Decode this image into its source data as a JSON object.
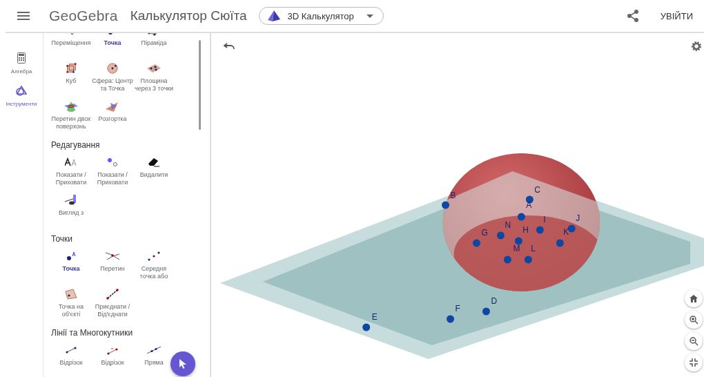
{
  "header": {
    "logo": "GeoGebra",
    "title": "Калькулятор Сюїта",
    "app_dropdown": "3D Калькулятор",
    "sign_in": "УВІЙТИ"
  },
  "rail": [
    {
      "label": "Алгебра",
      "selected": false
    },
    {
      "label": "Інструменти",
      "selected": true
    }
  ],
  "tool_sections": [
    {
      "tools": [
        {
          "label": "Переміщення",
          "selected": false
        },
        {
          "label": "Точка",
          "selected": true
        },
        {
          "label": "Піраміда",
          "selected": false
        },
        {
          "label": "Куб",
          "selected": false
        },
        {
          "label": "Сфера: Центр та Точка",
          "selected": false
        },
        {
          "label": "Площина через 3 точки",
          "selected": false
        },
        {
          "label": "Перетин двох поверхонь",
          "selected": false
        },
        {
          "label": "Розгортка",
          "selected": false
        }
      ]
    },
    {
      "title": "Редагування",
      "tools": [
        {
          "label": "Показати / Приховати",
          "selected": false
        },
        {
          "label": "Показати / Приховати",
          "selected": false
        },
        {
          "label": "Видалити",
          "selected": false
        },
        {
          "label": "Вигляд з",
          "selected": false
        }
      ]
    },
    {
      "title": "Точки",
      "tools": [
        {
          "label": "Точка",
          "selected": true
        },
        {
          "label": "Перетин",
          "selected": false
        },
        {
          "label": "Середня точка або",
          "selected": false
        },
        {
          "label": "Точка на об'єкті",
          "selected": false
        },
        {
          "label": "Приєднати / Від'єднати",
          "selected": false
        }
      ]
    },
    {
      "title": "Лінії та Многокутники",
      "tools": [
        {
          "label": "Відрізок",
          "selected": false
        },
        {
          "label": "Відрізок",
          "selected": false
        },
        {
          "label": "Пряма",
          "selected": false
        }
      ]
    }
  ],
  "points": [
    {
      "label": "B"
    },
    {
      "label": "C"
    },
    {
      "label": "A"
    },
    {
      "label": "I"
    },
    {
      "label": "J"
    },
    {
      "label": "N"
    },
    {
      "label": "H"
    },
    {
      "label": "G"
    },
    {
      "label": "K"
    },
    {
      "label": "M"
    },
    {
      "label": "L"
    },
    {
      "label": "E"
    },
    {
      "label": "F"
    },
    {
      "label": "D"
    }
  ]
}
